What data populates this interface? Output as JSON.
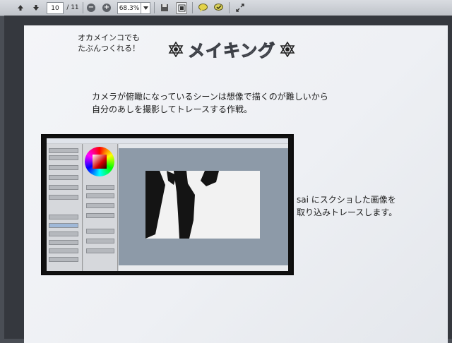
{
  "toolbar": {
    "page_current": "10",
    "page_total": "/ 11",
    "zoom": "68.3%",
    "icons": [
      "up-arrow-icon",
      "down-arrow-icon",
      "zoom-out-icon",
      "zoom-in-icon",
      "dropdown-icon",
      "save-icon",
      "fit-page-icon",
      "comment-icon",
      "highlight-icon",
      "expand-icon"
    ]
  },
  "slide": {
    "subtitle_line1": "オカメインコでも",
    "subtitle_line2": "たぶんつくれる！",
    "title": "メイキング",
    "desc_line1": "カメラが俯瞰になっているシーンは想像で描くのが難しいから",
    "desc_line2": "自分のあしを撮影してトレースする作戦。",
    "side_line1": "sai にスクショした画像を",
    "side_line2": "取り込みトレースします。"
  },
  "colors": {
    "background": "#4a4e55",
    "slide": "#f0f2f6",
    "title_fill": "#b8bcc4",
    "canvas_bg": "#8d9aa8"
  }
}
